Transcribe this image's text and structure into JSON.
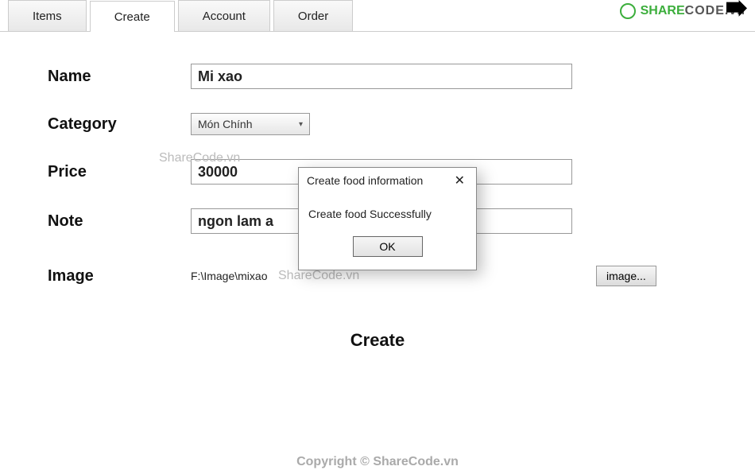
{
  "tabs": {
    "items": "Items",
    "create": "Create",
    "account": "Account",
    "order": "Order"
  },
  "logo": {
    "share": "SHARE",
    "code": "CODE",
    "suffix": ".vn"
  },
  "form": {
    "name": {
      "label": "Name",
      "value": "Mi xao"
    },
    "category": {
      "label": "Category",
      "selected": "Món Chính"
    },
    "price": {
      "label": "Price",
      "value": "30000"
    },
    "note": {
      "label": "Note",
      "value": "ngon lam a"
    },
    "image": {
      "label": "Image",
      "path": "F:\\Image\\mixao",
      "button": "image..."
    }
  },
  "actions": {
    "create": "Create"
  },
  "dialog": {
    "title": "Create food information",
    "message": "Create food Successfully",
    "ok": "OK"
  },
  "watermark": "ShareCode.vn",
  "footer": "Copyright © ShareCode.vn"
}
